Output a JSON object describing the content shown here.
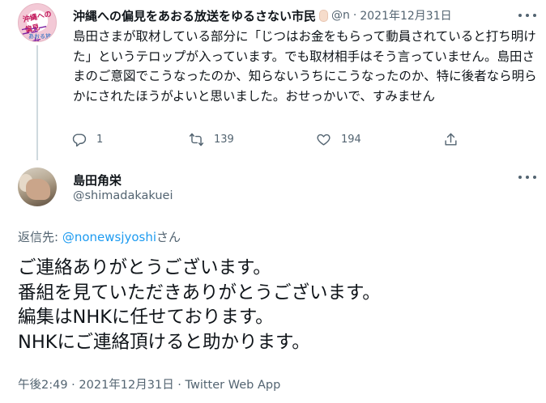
{
  "tweet1": {
    "avatar_text": [
      "沖縄への偏見",
      "ニュース女",
      "あおる放送"
    ],
    "display_name": "沖縄への偏見をあおる放送をゆるさない市民",
    "handle": "@n",
    "separator": "·",
    "date": "2021年12月31日",
    "body": "島田さまが取材している部分に「じつはお金をもらって動員されていると打ち明けた」というテロップが入っています。でも取材相手はそう言っていません。島田さまのご意図でこうなったのか、知らないうちにこうなったのか、特に後者なら明らかにされたほうがよいと思いました。おせっかいで、すみません",
    "actions": {
      "reply": {
        "icon": "reply-icon",
        "count": "1"
      },
      "retweet": {
        "icon": "retweet-icon",
        "count": "139"
      },
      "like": {
        "icon": "heart-icon",
        "count": "194"
      },
      "share": {
        "icon": "share-icon"
      }
    }
  },
  "tweet2": {
    "display_name": "島田角栄",
    "handle": "@shimadakakuei",
    "replying_prefix": "返信先: ",
    "replying_mention": "@nonewsjyoshi",
    "replying_suffix": "さん",
    "body": "ご連絡ありがとうございます。\n番組を見ていただきありがとうございます。\n編集はNHKに任せております。\nNHKにご連絡頂けると助かります。",
    "meta": "午後2:49 · 2021年12月31日 · Twitter Web App"
  },
  "colors": {
    "text": "#0f1419",
    "secondary": "#536471",
    "link": "#1d9bf0",
    "thread_line": "#cfd9de"
  }
}
